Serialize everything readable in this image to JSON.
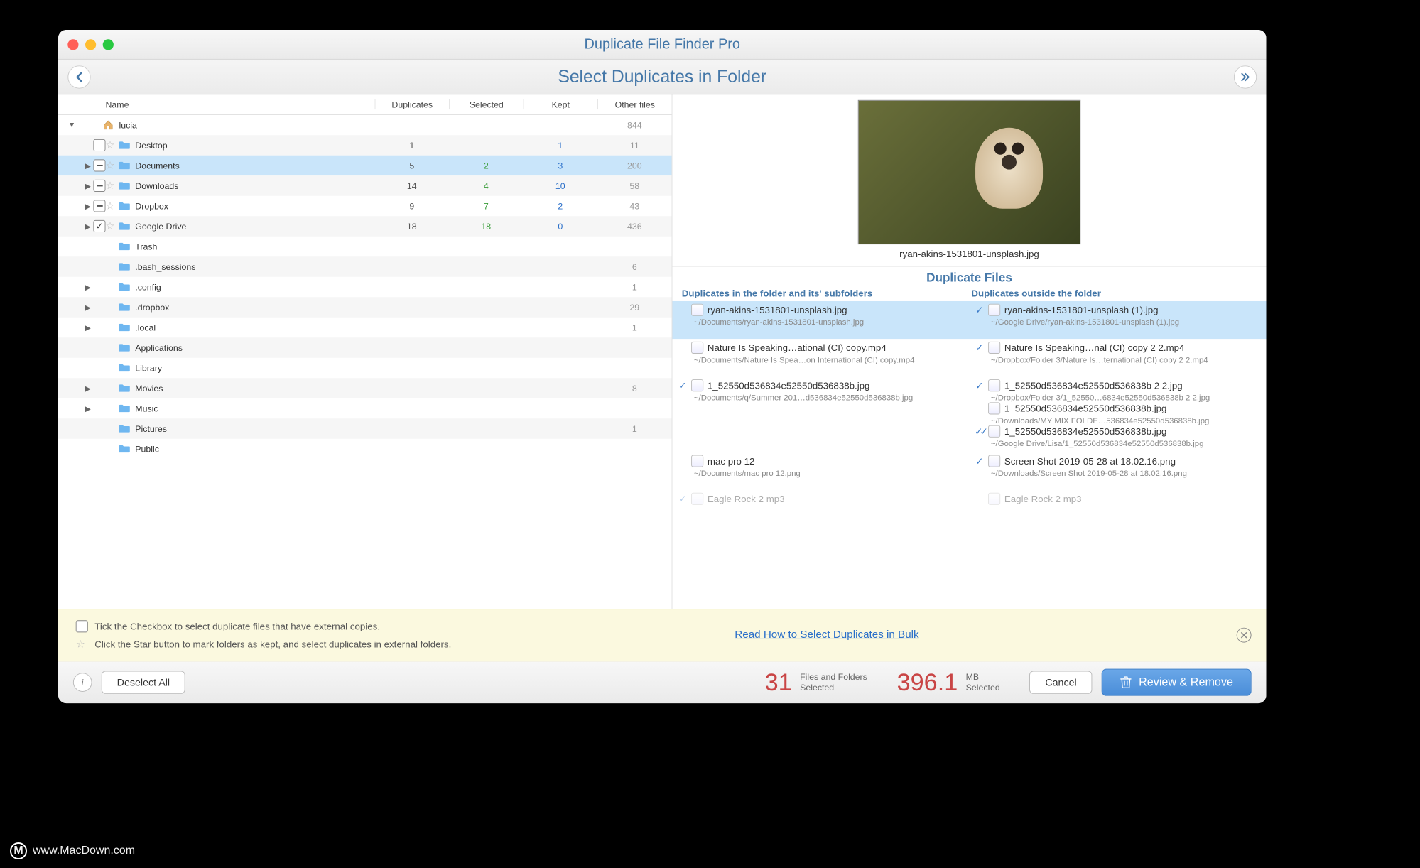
{
  "app": {
    "title": "Duplicate File Finder Pro",
    "subtitle": "Select Duplicates in Folder"
  },
  "columns": {
    "name": "Name",
    "duplicates": "Duplicates",
    "selected": "Selected",
    "kept": "Kept",
    "other": "Other files"
  },
  "tree": [
    {
      "level": 0,
      "disclosure": "open",
      "checkbox": null,
      "star": false,
      "icon": "home",
      "name": "lucia",
      "dup": "",
      "sel": "",
      "kept": "",
      "other": "844"
    },
    {
      "level": 1,
      "disclosure": null,
      "checkbox": "empty",
      "star": true,
      "icon": "folder",
      "name": "Desktop",
      "dup": "1",
      "sel": "",
      "kept": "1",
      "other": "11"
    },
    {
      "level": 1,
      "disclosure": "closed",
      "checkbox": "dash",
      "star": true,
      "icon": "folder",
      "name": "Documents",
      "dup": "5",
      "sel": "2",
      "kept": "3",
      "other": "200",
      "selected": true
    },
    {
      "level": 1,
      "disclosure": "closed",
      "checkbox": "dash",
      "star": true,
      "icon": "folder-dl",
      "name": "Downloads",
      "dup": "14",
      "sel": "4",
      "kept": "10",
      "other": "58"
    },
    {
      "level": 1,
      "disclosure": "closed",
      "checkbox": "dash",
      "star": true,
      "icon": "folder",
      "name": "Dropbox",
      "dup": "9",
      "sel": "7",
      "kept": "2",
      "other": "43"
    },
    {
      "level": 1,
      "disclosure": "closed",
      "checkbox": "checked",
      "star": true,
      "icon": "folder",
      "name": "Google Drive",
      "dup": "18",
      "sel": "18",
      "kept": "0",
      "other": "436"
    },
    {
      "level": 1,
      "disclosure": null,
      "checkbox": null,
      "star": false,
      "icon": "folder",
      "name": "Trash",
      "dup": "",
      "sel": "",
      "kept": "",
      "other": ""
    },
    {
      "level": 1,
      "disclosure": null,
      "checkbox": null,
      "star": false,
      "icon": "folder",
      "name": ".bash_sessions",
      "dup": "",
      "sel": "",
      "kept": "",
      "other": "6"
    },
    {
      "level": 1,
      "disclosure": "closed",
      "checkbox": null,
      "star": false,
      "icon": "folder",
      "name": ".config",
      "dup": "",
      "sel": "",
      "kept": "",
      "other": "1"
    },
    {
      "level": 1,
      "disclosure": "closed",
      "checkbox": null,
      "star": false,
      "icon": "folder",
      "name": ".dropbox",
      "dup": "",
      "sel": "",
      "kept": "",
      "other": "29"
    },
    {
      "level": 1,
      "disclosure": "closed",
      "checkbox": null,
      "star": false,
      "icon": "folder",
      "name": ".local",
      "dup": "",
      "sel": "",
      "kept": "",
      "other": "1"
    },
    {
      "level": 1,
      "disclosure": null,
      "checkbox": null,
      "star": false,
      "icon": "folder",
      "name": "Applications",
      "dup": "",
      "sel": "",
      "kept": "",
      "other": ""
    },
    {
      "level": 1,
      "disclosure": null,
      "checkbox": null,
      "star": false,
      "icon": "folder",
      "name": "Library",
      "dup": "",
      "sel": "",
      "kept": "",
      "other": ""
    },
    {
      "level": 1,
      "disclosure": "closed",
      "checkbox": null,
      "star": false,
      "icon": "folder-movies",
      "name": "Movies",
      "dup": "",
      "sel": "",
      "kept": "",
      "other": "8"
    },
    {
      "level": 1,
      "disclosure": "closed",
      "checkbox": null,
      "star": false,
      "icon": "folder-music",
      "name": "Music",
      "dup": "",
      "sel": "",
      "kept": "",
      "other": ""
    },
    {
      "level": 1,
      "disclosure": null,
      "checkbox": null,
      "star": false,
      "icon": "folder-pics",
      "name": "Pictures",
      "dup": "",
      "sel": "",
      "kept": "",
      "other": "1"
    },
    {
      "level": 1,
      "disclosure": null,
      "checkbox": null,
      "star": false,
      "icon": "folder",
      "name": "Public",
      "dup": "",
      "sel": "",
      "kept": "",
      "other": ""
    }
  ],
  "preview": {
    "filename": "ryan-akins-1531801-unsplash.jpg"
  },
  "dup": {
    "title": "Duplicate Files",
    "left_header": "Duplicates in the folder and its' subfolders",
    "right_header": "Duplicates outside the folder",
    "rows": [
      {
        "selected": true,
        "left": [
          {
            "check": "",
            "icon": "img",
            "name": "ryan-akins-1531801-unsplash.jpg",
            "path": "~/Documents/ryan-akins-1531801-unsplash.jpg"
          }
        ],
        "right": [
          {
            "check": "✓",
            "icon": "img",
            "name": "ryan-akins-1531801-unsplash (1).jpg",
            "path": "~/Google Drive/ryan-akins-1531801-unsplash (1).jpg"
          }
        ]
      },
      {
        "left": [
          {
            "check": "",
            "icon": "vid",
            "name": "Nature Is Speaking…ational (CI) copy.mp4",
            "path": "~/Documents/Nature Is Spea…on International (CI) copy.mp4"
          }
        ],
        "right": [
          {
            "check": "✓",
            "icon": "vid",
            "name": "Nature Is Speaking…nal (CI) copy 2 2.mp4",
            "path": "~/Dropbox/Folder 3/Nature Is…ternational (CI) copy 2 2.mp4"
          }
        ]
      },
      {
        "left": [
          {
            "check": "✓",
            "icon": "img",
            "name": "1_52550d536834e52550d536838b.jpg",
            "path": "~/Documents/q/Summer 201…d536834e52550d536838b.jpg"
          }
        ],
        "right": [
          {
            "check": "✓",
            "icon": "img",
            "name": "1_52550d536834e52550d536838b 2 2.jpg",
            "path": "~/Dropbox/Folder 3/1_52550…6834e52550d536838b 2 2.jpg"
          },
          {
            "check": "",
            "icon": "img",
            "name": "1_52550d536834e52550d536838b.jpg",
            "path": "~/Downloads/MY MIX FOLDE…536834e52550d536838b.jpg"
          },
          {
            "check": "✓✓",
            "icon": "img",
            "name": "1_52550d536834e52550d536838b.jpg",
            "path": "~/Google Drive/Lisa/1_52550d536834e52550d536838b.jpg"
          }
        ]
      },
      {
        "left": [
          {
            "check": "",
            "icon": "img",
            "name": "mac pro 12",
            "path": "~/Documents/mac pro 12.png"
          }
        ],
        "right": [
          {
            "check": "✓",
            "icon": "img",
            "name": "Screen Shot 2019-05-28 at 18.02.16.png",
            "path": "~/Downloads/Screen Shot 2019-05-28 at 18.02.16.png"
          }
        ]
      },
      {
        "cut": true,
        "left": [
          {
            "check": "✓",
            "icon": "aud",
            "name": "Eagle Rock 2 mp3",
            "path": ""
          }
        ],
        "right": [
          {
            "check": "",
            "icon": "aud",
            "name": "Eagle Rock 2 mp3",
            "path": ""
          }
        ]
      }
    ]
  },
  "hints": {
    "line1": "Tick the Checkbox to select duplicate files that have external copies.",
    "line2": "Click the Star button to mark folders as kept, and select duplicates in external folders.",
    "link": "Read How to Select Duplicates in Bulk"
  },
  "bottom": {
    "deselect": "Deselect All",
    "count": "31",
    "count_lbl1": "Files and Folders",
    "count_lbl2": "Selected",
    "size": "396.1",
    "size_unit": "MB",
    "size_lbl2": "Selected",
    "cancel": "Cancel",
    "review": "Review & Remove"
  },
  "site": "www.MacDown.com"
}
